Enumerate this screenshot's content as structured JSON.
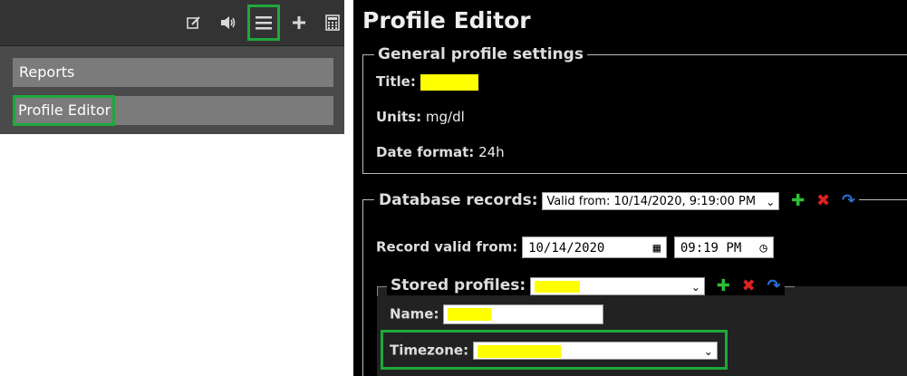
{
  "left": {
    "menu": [
      {
        "label": "Reports"
      },
      {
        "label": "Profile Editor"
      }
    ]
  },
  "editor": {
    "heading": "Profile Editor",
    "general": {
      "legend": "General profile settings",
      "title_label": "Title:",
      "units_label": "Units:",
      "units_value": "mg/dl",
      "date_format_label": "Date format:",
      "date_format_value": "24h"
    },
    "database": {
      "legend": "Database records:",
      "valid_from_select": "Valid from: 10/14/2020, 9:19:00 PM",
      "record_valid_label": "Record valid from:",
      "date_value": "10/14/2020",
      "time_value": "09:19 PM"
    },
    "stored": {
      "legend": "Stored profiles:",
      "name_label": "Name:",
      "timezone_label": "Timezone:"
    }
  },
  "colors": {
    "highlight": "#1fa83c",
    "redacted": "#ffff00"
  }
}
